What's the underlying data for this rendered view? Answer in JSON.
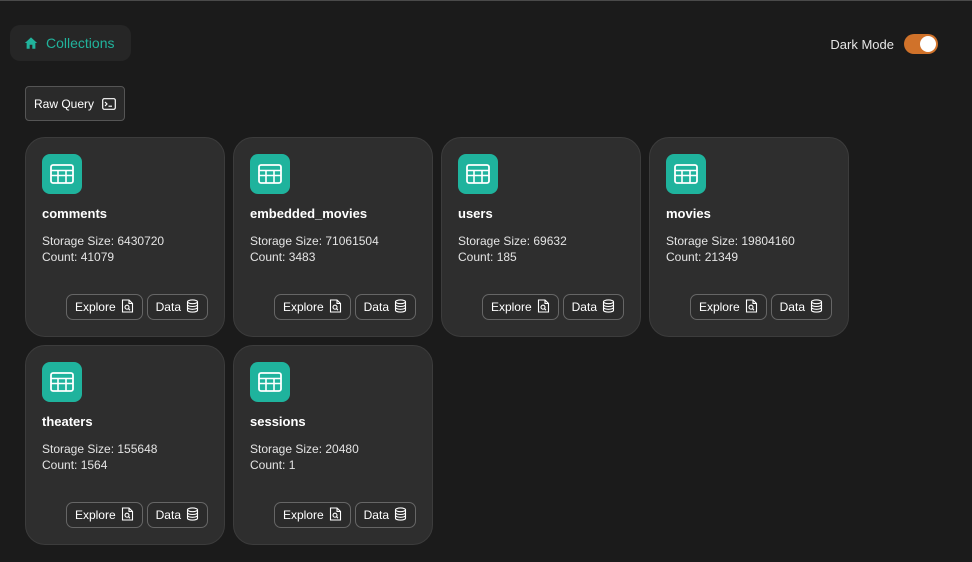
{
  "breadcrumb": {
    "label": "Collections",
    "icon": "home-icon",
    "color": "#21b39c"
  },
  "header": {
    "dark_mode_label": "Dark Mode",
    "dark_mode_on": true,
    "toggle_color": "#d0722a"
  },
  "toolbar": {
    "raw_query_label": "Raw Query",
    "raw_query_icon": "terminal-icon"
  },
  "labels": {
    "storage_prefix": "Storage Size: ",
    "count_prefix": "Count: ",
    "explore": "Explore",
    "data": "Data"
  },
  "collections": [
    {
      "name": "comments",
      "storage_size": "6430720",
      "count": "41079"
    },
    {
      "name": "embedded_movies",
      "storage_size": "71061504",
      "count": "3483"
    },
    {
      "name": "users",
      "storage_size": "69632",
      "count": "185"
    },
    {
      "name": "movies",
      "storage_size": "19804160",
      "count": "21349"
    },
    {
      "name": "theaters",
      "storage_size": "155648",
      "count": "1564"
    },
    {
      "name": "sessions",
      "storage_size": "20480",
      "count": "1"
    }
  ],
  "colors": {
    "accent": "#1fb39d",
    "background": "#1b1b1b",
    "card": "#2e2e2e"
  }
}
